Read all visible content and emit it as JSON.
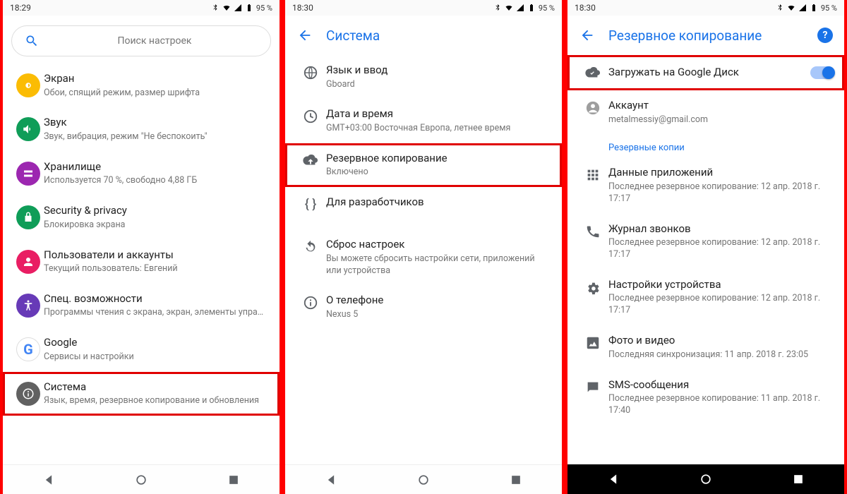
{
  "status": {
    "time1": "18:29",
    "time2": "18:30",
    "time3": "18:30",
    "battery": "95 %"
  },
  "search_placeholder": "Поиск настроек",
  "phone1": {
    "items": [
      {
        "title": "Экран",
        "sub": "Обои, спящий режим, размер шрифта"
      },
      {
        "title": "Звук",
        "sub": "Звук, вибрация, режим \"Не беспокоить\""
      },
      {
        "title": "Хранилище",
        "sub": "Используется 70 %, свободно 4,88 ГБ"
      },
      {
        "title": "Security & privacy",
        "sub": "Блокировка экрана"
      },
      {
        "title": "Пользователи и аккаунты",
        "sub": "Текущий пользователь: Евгений"
      },
      {
        "title": "Спец. возможности",
        "sub": "Программы чтения с экрана, экран, элементы управле…"
      },
      {
        "title": "Google",
        "sub": "Сервисы и настройки"
      },
      {
        "title": "Система",
        "sub": "Язык, время, резервное копирование и обновления"
      }
    ]
  },
  "phone2": {
    "header": "Система",
    "items": [
      {
        "title": "Язык и ввод",
        "sub": "Gboard"
      },
      {
        "title": "Дата и время",
        "sub": "GMT+03:00 Восточная Европа, летнее время"
      },
      {
        "title": "Резервное копирование",
        "sub": "Включено"
      },
      {
        "title": "Для разработчиков",
        "sub": ""
      },
      {
        "title": "Сброс настроек",
        "sub": "Вы можете сбросить настройки сети, приложений или устройства"
      },
      {
        "title": "О телефоне",
        "sub": "Nexus 5"
      }
    ]
  },
  "phone3": {
    "header": "Резервное копирование",
    "drive_row": "Загружать на Google Диск",
    "account": {
      "title": "Аккаунт",
      "sub": "metalmessiy@gmail.com"
    },
    "section": "Резервные копии",
    "items": [
      {
        "title": "Данные приложений",
        "sub": "Последнее резервное копирование: 12 апр. 2018 г. 17:17"
      },
      {
        "title": "Журнал звонков",
        "sub": "Последнее резервное копирование: 12 апр. 2018 г. 17:17"
      },
      {
        "title": "Настройки устройства",
        "sub": "Последнее резервное копирование: 12 апр. 2018 г. 17:17"
      },
      {
        "title": "Фото и видео",
        "sub": "Последняя синхронизация: 11 апр. 2018 г. 23:05"
      },
      {
        "title": "SMS-сообщения",
        "sub": "Последнее резервное копирование: 11 апр. 2018 г. 17:40"
      }
    ]
  },
  "icons": {
    "colors": [
      "#fbbc04",
      "#0f9d58",
      "#9c27b0",
      "#0f9d58",
      "#e91e63",
      "#673ab7",
      "#ffffff",
      "#616161"
    ]
  }
}
